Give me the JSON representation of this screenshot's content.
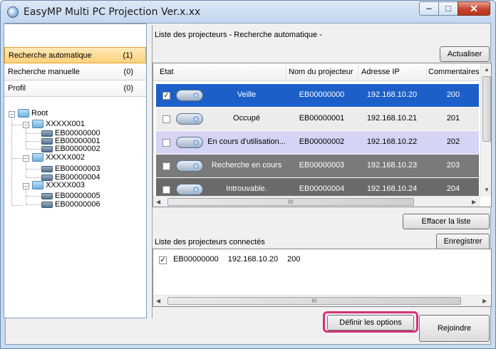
{
  "window": {
    "title": "EasyMP Multi PC Projection Ver.x.xx"
  },
  "sidebar": {
    "items": [
      {
        "label": "Recherche automatique",
        "count": "(1)"
      },
      {
        "label": "Recherche manuelle",
        "count": "(0)"
      },
      {
        "label": "Profil",
        "count": "(0)"
      }
    ],
    "tree": {
      "root": "Root",
      "groups": [
        {
          "name": "XXXXX001",
          "children": [
            "EB00000000",
            "EB00000001",
            "EB00000002"
          ]
        },
        {
          "name": "XXXXX002",
          "children": [
            "EB00000003",
            "EB00000004"
          ]
        },
        {
          "name": "XXXXX003",
          "children": [
            "EB00000005",
            "EB00000006"
          ]
        }
      ]
    }
  },
  "main": {
    "list_title": "Liste des projecteurs - Recherche automatique -",
    "refresh_label": "Actualiser",
    "columns": [
      "Etat",
      "Nom du projecteur",
      "Adresse IP",
      "Commentaires"
    ],
    "rows": [
      {
        "checked": true,
        "status": "Veille",
        "name": "EB00000000",
        "ip": "192.168.10.20",
        "comment": "200",
        "bg": "#1c5fc8",
        "fg": "#ffffff"
      },
      {
        "checked": false,
        "status": "Occupé",
        "name": "EB00000001",
        "ip": "192.168.10.21",
        "comment": "201",
        "bg": "#ececec",
        "fg": "#000000"
      },
      {
        "checked": false,
        "status": "En cours d'utilisation...",
        "name": "EB00000002",
        "ip": "192.168.10.22",
        "comment": "202",
        "bg": "#d6d4f4",
        "fg": "#000000"
      },
      {
        "checked": false,
        "status": "Recherche en cours",
        "name": "EB00000003",
        "ip": "192.168.10.23",
        "comment": "203",
        "bg": "#7a7a7a",
        "fg": "#ffffff"
      },
      {
        "checked": false,
        "status": "Introuvable.",
        "name": "EB00000004",
        "ip": "192.168.10.24",
        "comment": "204",
        "bg": "#6a6a6a",
        "fg": "#ffffff"
      }
    ],
    "scroll_h_label": "III",
    "clear_label": "Effacer la liste",
    "connected_title": "Liste des projecteurs connectés",
    "save_label": "Enregistrer",
    "connected": {
      "checked": true,
      "name": "EB00000000",
      "ip": "192.168.10.20",
      "comment": "200"
    },
    "options_label": "Définir les options",
    "join_label": "Rejoindre"
  },
  "colors": {
    "highlight": "#d6317a",
    "selected_row": "#1c5fc8"
  }
}
